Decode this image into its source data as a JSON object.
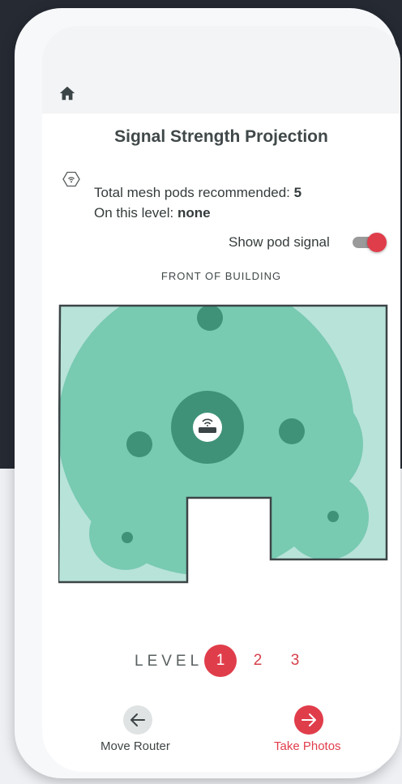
{
  "title": "Signal Strength Projection",
  "info": {
    "total_label": "Total mesh pods recommended:",
    "total_value": "5",
    "level_label": "On this level:",
    "level_value": "none"
  },
  "pod_signal": {
    "label": "Show pod signal",
    "enabled": true
  },
  "front_label": "FRONT OF BUILDING",
  "levels": {
    "label": "LEVEL",
    "items": [
      "1",
      "2",
      "3"
    ],
    "selected": "1"
  },
  "nav": {
    "back_label": "Move Router",
    "forward_label": "Take Photos"
  },
  "colors": {
    "accent": "#e03d4b",
    "signal_light": "#b8e3d9",
    "signal_medium": "#78cab1",
    "signal_dark": "#3f9278",
    "wall": "#3b4446"
  }
}
